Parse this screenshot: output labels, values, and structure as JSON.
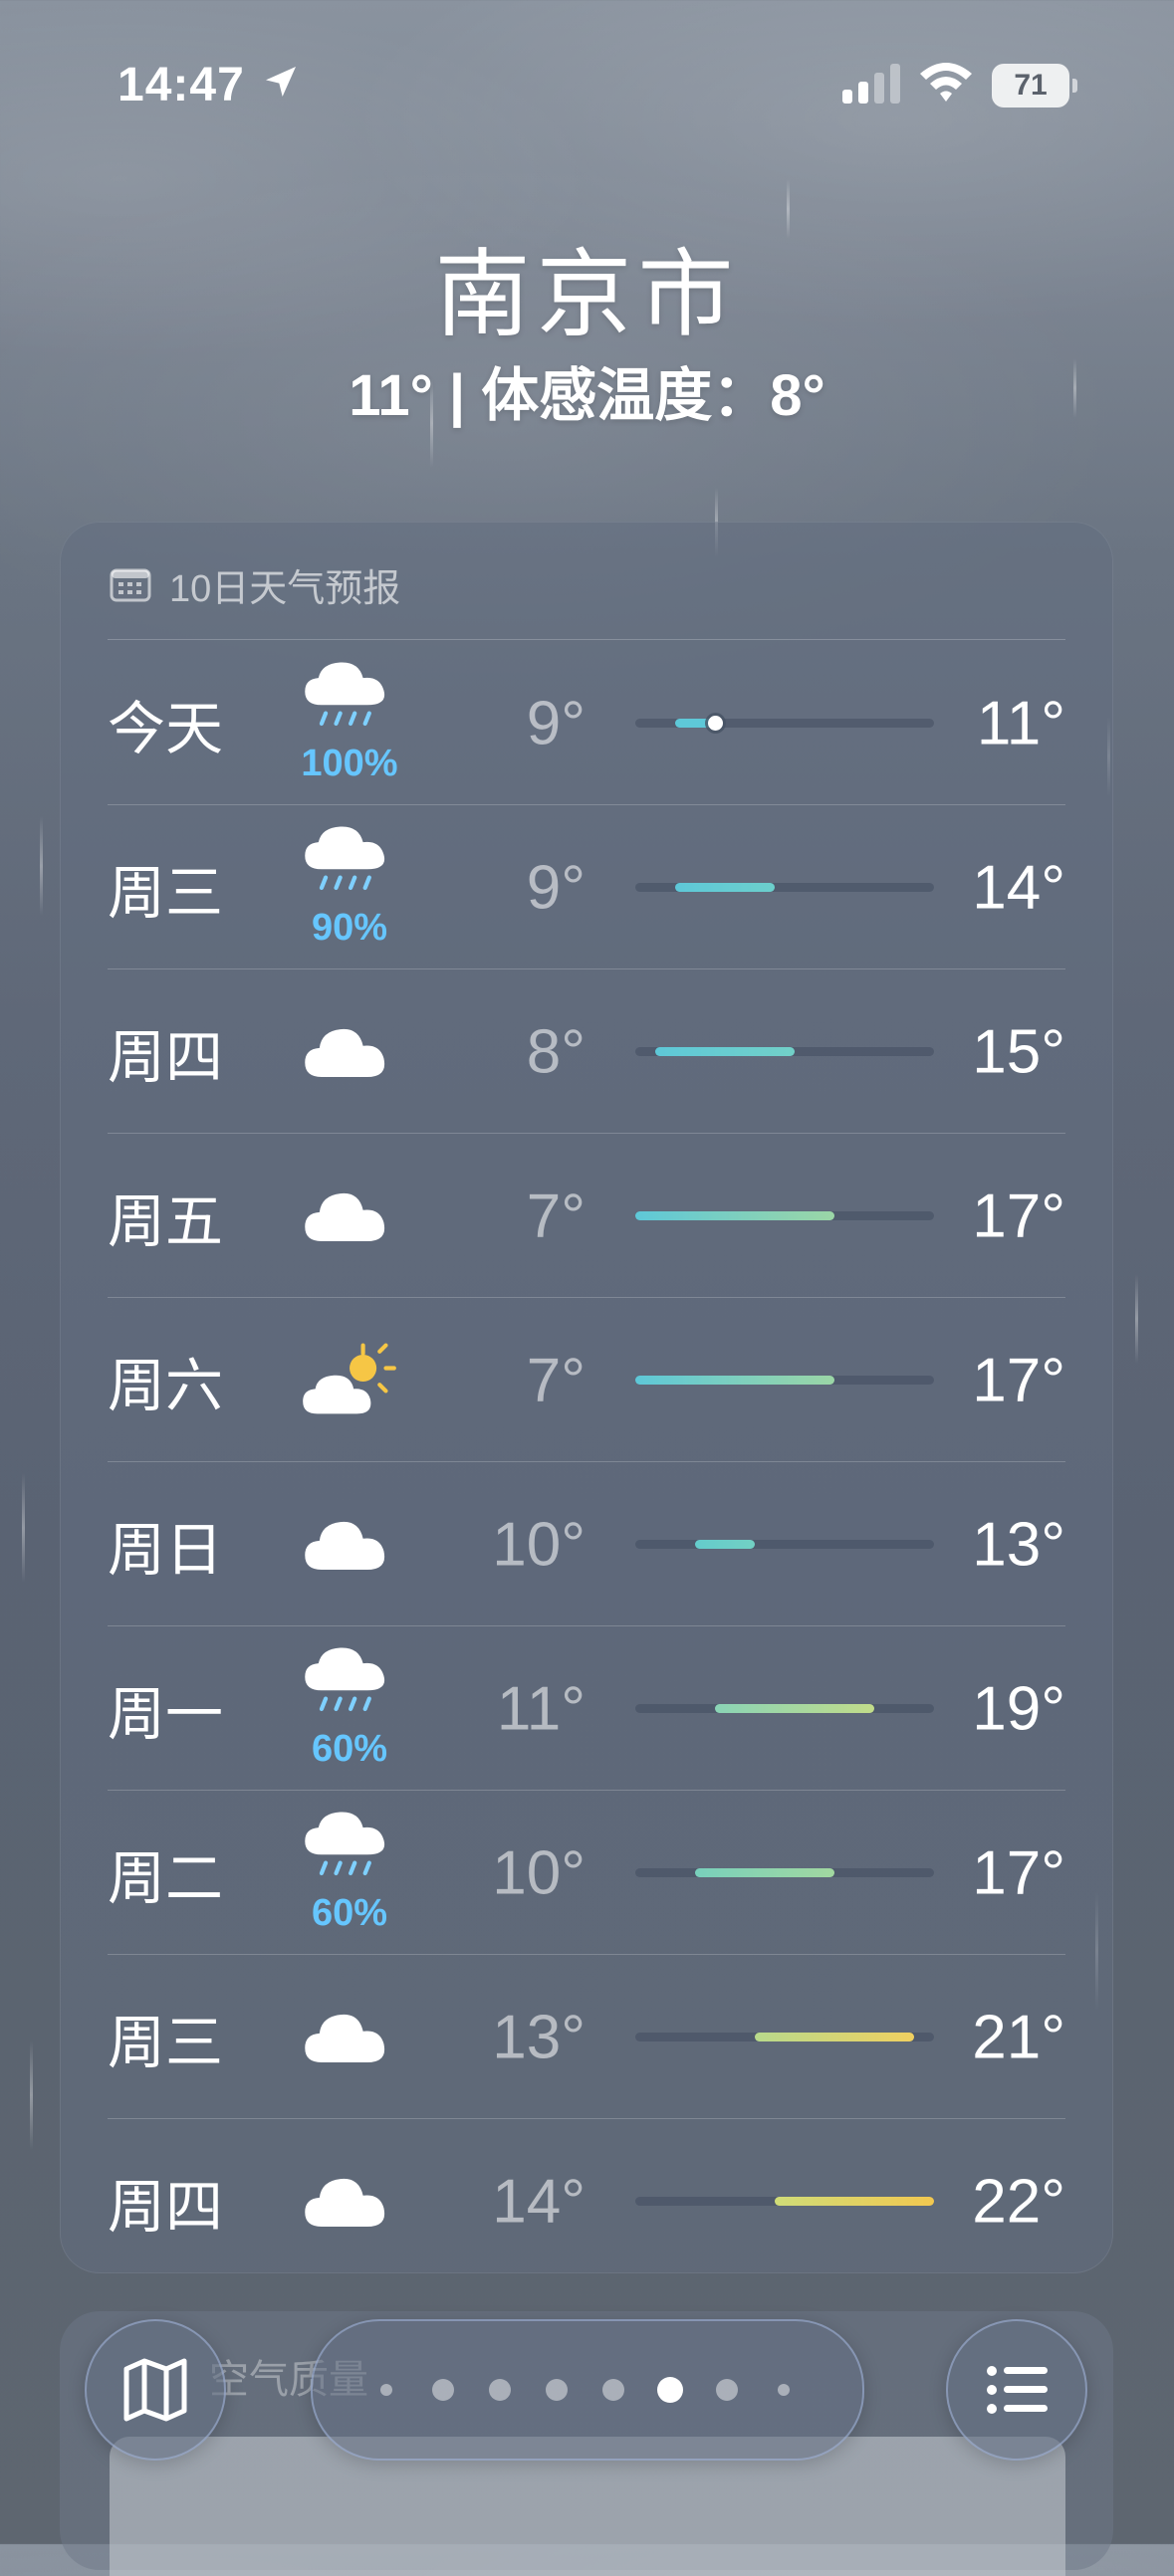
{
  "status_bar": {
    "time": "14:47",
    "battery": "71"
  },
  "location": {
    "city": "南京市",
    "current_temp": "11°",
    "feels_like": "体感温度：8°"
  },
  "forecast": {
    "title": "10日天气预报",
    "scale_min": 7,
    "scale_max": 22,
    "days": [
      {
        "day": "今天",
        "icon": "rain-cloud-icon",
        "precip": "100%",
        "low": "9°",
        "high": "11°",
        "low_value": 9,
        "high_value": 11,
        "current_value": 11,
        "bar_colors": [
          "#5ec8d8",
          "#5ec8d8"
        ]
      },
      {
        "day": "周三",
        "icon": "rain-cloud-icon",
        "precip": "90%",
        "low": "9°",
        "high": "14°",
        "low_value": 9,
        "high_value": 14,
        "bar_colors": [
          "#5ec8d8",
          "#6ccfcc"
        ]
      },
      {
        "day": "周四",
        "icon": "cloud-icon",
        "precip": "",
        "low": "8°",
        "high": "15°",
        "low_value": 8,
        "high_value": 15,
        "bar_colors": [
          "#5ec8d8",
          "#72d0c8"
        ]
      },
      {
        "day": "周五",
        "icon": "cloud-icon",
        "precip": "",
        "low": "7°",
        "high": "17°",
        "low_value": 7,
        "high_value": 17,
        "bar_colors": [
          "#5ec8d8",
          "#9bd6a6"
        ]
      },
      {
        "day": "周六",
        "icon": "partly-sunny-icon",
        "precip": "",
        "low": "7°",
        "high": "17°",
        "low_value": 7,
        "high_value": 17,
        "bar_colors": [
          "#5ec8d8",
          "#9bd6a6"
        ]
      },
      {
        "day": "周日",
        "icon": "cloud-icon",
        "precip": "",
        "low": "10°",
        "high": "13°",
        "low_value": 10,
        "high_value": 13,
        "bar_colors": [
          "#64cccc",
          "#72d0c4"
        ]
      },
      {
        "day": "周一",
        "icon": "rain-cloud-icon",
        "precip": "60%",
        "low": "11°",
        "high": "19°",
        "low_value": 11,
        "high_value": 19,
        "bar_colors": [
          "#8ad4b6",
          "#c2dc8a"
        ]
      },
      {
        "day": "周二",
        "icon": "rain-cloud-icon",
        "precip": "60%",
        "low": "10°",
        "high": "17°",
        "low_value": 10,
        "high_value": 17,
        "bar_colors": [
          "#78d0bc",
          "#a2d8a0"
        ]
      },
      {
        "day": "周三",
        "icon": "cloud-icon",
        "precip": "",
        "low": "13°",
        "high": "21°",
        "low_value": 13,
        "high_value": 21,
        "bar_colors": [
          "#b8da8c",
          "#f0d060"
        ]
      },
      {
        "day": "周四",
        "icon": "cloud-icon",
        "precip": "",
        "low": "14°",
        "high": "22°",
        "low_value": 14,
        "high_value": 22,
        "bar_colors": [
          "#d0dc78",
          "#f2c850"
        ]
      }
    ]
  },
  "air_quality": {
    "label": "空气质量"
  },
  "page_indicator": {
    "count": 8,
    "active_index": 5
  }
}
